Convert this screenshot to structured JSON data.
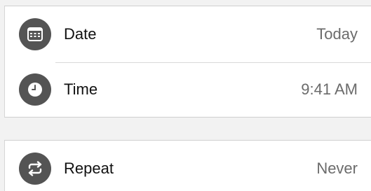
{
  "settings": {
    "rows": [
      {
        "label": "Date",
        "value": "Today",
        "icon": "calendar-icon"
      },
      {
        "label": "Time",
        "value": "9:41 AM",
        "icon": "clock-icon"
      }
    ],
    "repeat": {
      "label": "Repeat",
      "value": "Never",
      "icon": "repeat-icon"
    }
  },
  "colors": {
    "icon_bg": "#545454",
    "value_text": "#6b6b6b",
    "label_text": "#111111",
    "group_bg": "#ffffff",
    "page_bg": "#f2f2f2"
  }
}
